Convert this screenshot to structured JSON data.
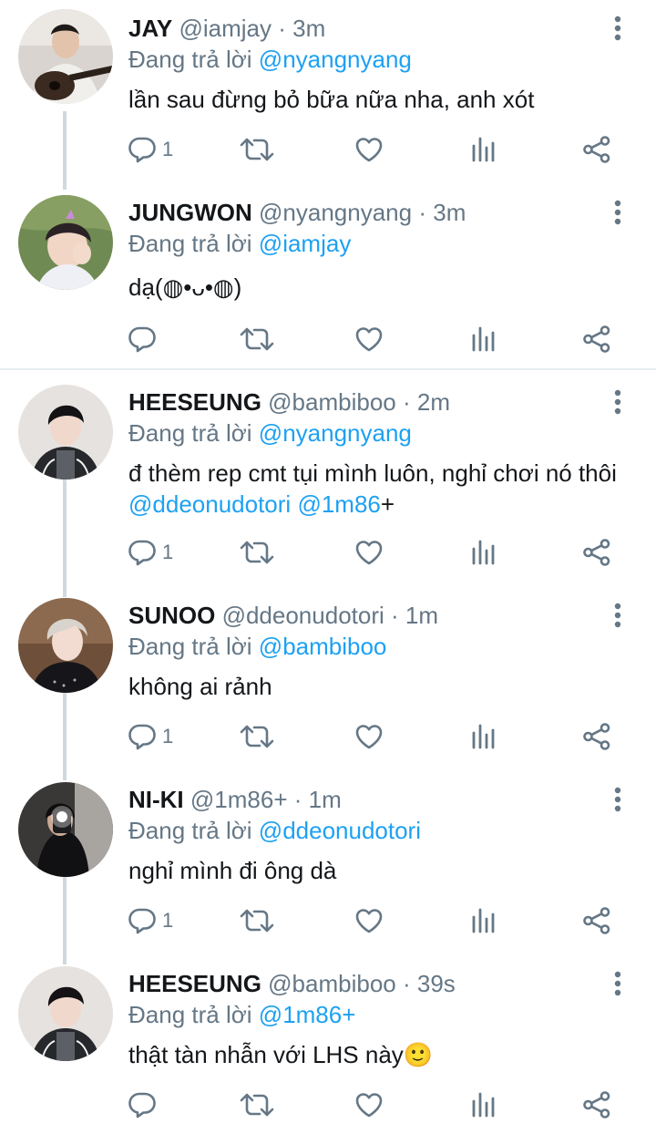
{
  "reply_prefix": "Đang trả lời",
  "colors": {
    "accent": "#1da1f2",
    "muted": "#657786",
    "thread_line": "#cfd9de"
  },
  "tweets": [
    {
      "name": "JAY",
      "handle": "@iamjay",
      "separator": "·",
      "time": "3m",
      "replying_to": "@nyangnyang",
      "text": "lần sau đừng bỏ bữa nữa nha, anh xót",
      "reply_count": "1",
      "avatar": "guitar-photo"
    },
    {
      "name": "JUNGWON",
      "handle": "@nyangnyang",
      "separator": "·",
      "time": "3m",
      "replying_to": "@iamjay",
      "text": "dạ(◍•ᴗ•◍)",
      "reply_count": "",
      "avatar": "wink-photo"
    },
    {
      "name": "HEESEUNG",
      "handle": "@bambiboo",
      "separator": "·",
      "time": "2m",
      "replying_to": "@nyangnyang",
      "text_before": "đ thèm rep cmt tụi mình luôn, nghỉ chơi nó thôi",
      "mention_1": "@ddeonudotori",
      "mention_2": "@1m86",
      "text_after": "+",
      "reply_count": "1",
      "avatar": "portrait-photo"
    },
    {
      "name": "SUNOO",
      "handle": "@ddeonudotori",
      "separator": "·",
      "time": "1m",
      "replying_to": "@bambiboo",
      "text": "không ai rảnh",
      "reply_count": "1",
      "avatar": "blonde-photo"
    },
    {
      "name": "NI-KI",
      "handle": "@1m86+",
      "separator": "·",
      "time": "1m",
      "replying_to": "@ddeonudotori",
      "text": "nghỉ mình đi ông dà",
      "reply_count": "1",
      "avatar": "mirror-selfie-photo"
    },
    {
      "name": "HEESEUNG",
      "handle": "@bambiboo",
      "separator": "·",
      "time": "39s",
      "replying_to": "@1m86+",
      "text": "thật tàn nhẫn với LHS này🙂",
      "reply_count": "",
      "avatar": "portrait-photo"
    }
  ],
  "action_icons": [
    "reply-icon",
    "retweet-icon",
    "like-icon",
    "analytics-icon",
    "share-icon"
  ]
}
